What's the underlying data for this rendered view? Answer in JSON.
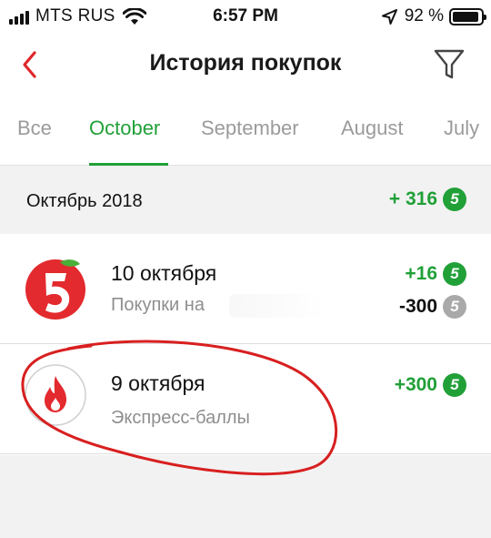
{
  "status_bar": {
    "carrier": "MTS RUS",
    "time": "6:57 PM",
    "battery": "92 %",
    "battery_level": 0.92
  },
  "nav": {
    "title": "История покупок",
    "back_icon": "chevron-left-icon",
    "filter_icon": "filter-icon"
  },
  "tabs": [
    {
      "label": "Все",
      "active": false
    },
    {
      "label": "October",
      "active": true
    },
    {
      "label": "September",
      "active": false
    },
    {
      "label": "August",
      "active": false
    },
    {
      "label": "July",
      "active": false
    }
  ],
  "month": {
    "label": "Октябрь 2018",
    "total": "+ 316"
  },
  "transactions": [
    {
      "date": "10 октября",
      "subtitle": "Покупки на",
      "earned": "+16",
      "spent": "-300",
      "logo": "pyaterochka-logo"
    },
    {
      "date": "9 октября",
      "subtitle": "Экспресс-баллы",
      "earned": "+300",
      "logo": "flame-icon"
    }
  ],
  "badge_symbol": "5",
  "colors": {
    "accent_green": "#21a038",
    "nav_red": "#e0262b",
    "annotation_red": "#d81f1f",
    "muted_badge": "#a9a9a9"
  }
}
